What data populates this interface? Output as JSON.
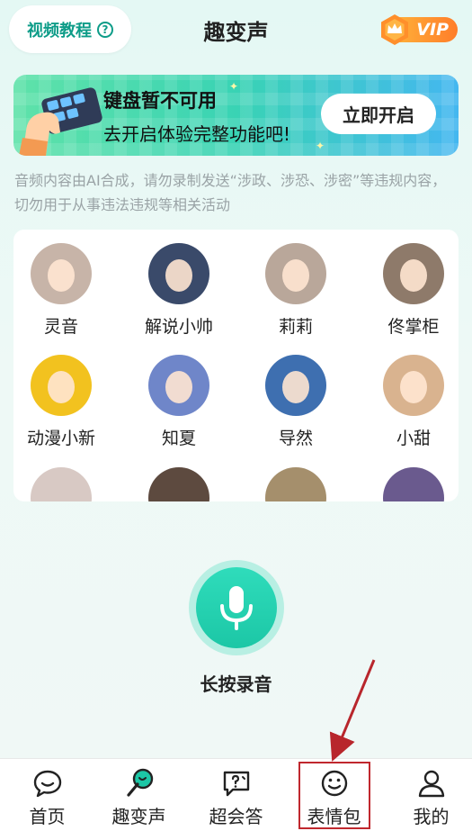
{
  "header": {
    "tutorial_label": "视频教程",
    "help_icon": "question-circle-icon",
    "title": "趣变声",
    "vip_label": "VIP"
  },
  "banner": {
    "title": "键盘暂不可用",
    "subtitle": "去开启体验完整功能吧!",
    "button_label": "立即开启"
  },
  "notice": "音频内容由AI合成，请勿录制发送“涉政、涉恐、涉密”等违规内容，切勿用于从事违法违规等相关活动",
  "voices": [
    {
      "name": "灵音",
      "color": "#c7b4a8"
    },
    {
      "name": "解说小帅",
      "color": "#3a4a6a"
    },
    {
      "name": "莉莉",
      "color": "#b9a79a"
    },
    {
      "name": "佟掌柜",
      "color": "#8e7a6a"
    },
    {
      "name": "动漫小新",
      "color": "#f2c21f"
    },
    {
      "name": "知夏",
      "color": "#6f86c9"
    },
    {
      "name": "导然",
      "color": "#3e6fb0"
    },
    {
      "name": "小甜",
      "color": "#d9b38f"
    },
    {
      "name": "",
      "color": "#d8c9c4"
    },
    {
      "name": "",
      "color": "#5d4a3f"
    },
    {
      "name": "",
      "color": "#a58f6c"
    },
    {
      "name": "",
      "color": "#6a5a8e"
    }
  ],
  "record": {
    "label": "长按录音",
    "icon": "microphone-icon"
  },
  "tabs": [
    {
      "label": "首页",
      "icon": "chat-bubble-icon"
    },
    {
      "label": "趣变声",
      "icon": "voice-changer-icon"
    },
    {
      "label": "超会答",
      "icon": "qa-bubble-icon"
    },
    {
      "label": "表情包",
      "icon": "smiley-icon"
    },
    {
      "label": "我的",
      "icon": "user-icon"
    }
  ],
  "colors": {
    "accent": "#1cc7a6",
    "highlight": "#c0282e",
    "vip": "#ff8a2a"
  }
}
